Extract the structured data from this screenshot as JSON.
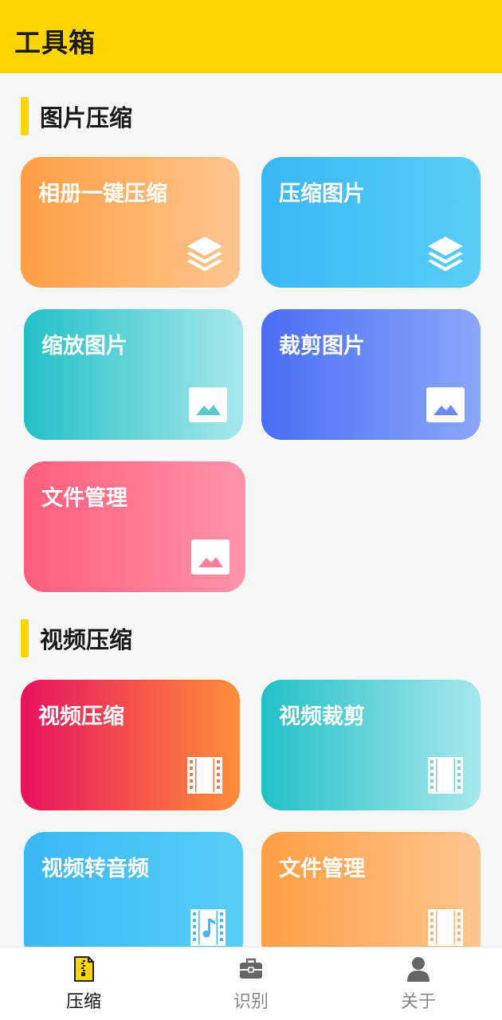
{
  "header": {
    "title": "工具箱"
  },
  "sections": [
    {
      "title": "图片压缩",
      "cards": [
        {
          "label": "相册一键压缩",
          "icon": "layers-icon"
        },
        {
          "label": "压缩图片",
          "icon": "layers-icon"
        },
        {
          "label": "缩放图片",
          "icon": "image-icon"
        },
        {
          "label": "裁剪图片",
          "icon": "image-icon"
        },
        {
          "label": "文件管理",
          "icon": "image-icon"
        }
      ]
    },
    {
      "title": "视频压缩",
      "cards": [
        {
          "label": "视频压缩",
          "icon": "film-icon"
        },
        {
          "label": "视频裁剪",
          "icon": "film-icon"
        },
        {
          "label": "视频转音频",
          "icon": "film-music-icon"
        },
        {
          "label": "文件管理",
          "icon": "film-icon"
        }
      ]
    }
  ],
  "tabbar": {
    "active": 0,
    "tabs": [
      {
        "label": "压缩",
        "icon": "zip-file-icon"
      },
      {
        "label": "识别",
        "icon": "toolbox-icon"
      },
      {
        "label": "关于",
        "icon": "person-icon"
      }
    ]
  },
  "colors": {
    "accent": "#ffd500",
    "tab_active_icon": "#ffd500",
    "tab_inactive_icon": "#666666"
  }
}
